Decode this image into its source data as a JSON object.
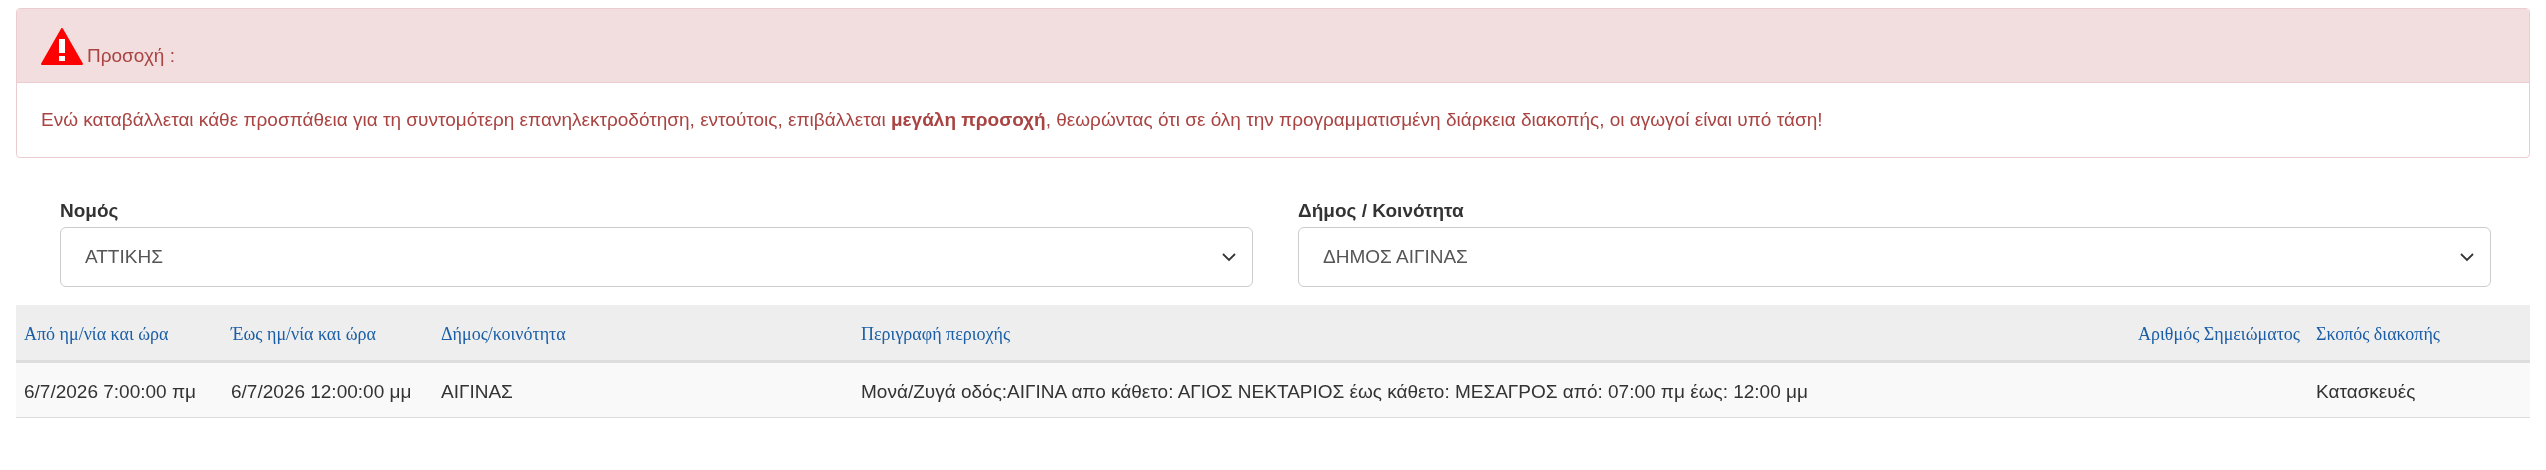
{
  "alert": {
    "title": "Προσοχή :",
    "message": "Ενώ καταβάλλεται κάθε προσπάθεια για τη συντομότερη επανηλεκτροδότηση, εντούτοις, επιβάλλεται **μεγάλη προσοχή**, θεωρώντας ότι σε όλη την προγραμματισμένη διάρκεια διακοπής, οι αγωγοί είναι υπό τάση!"
  },
  "filters": [
    {
      "label": "Νομός",
      "value": "ΑΤΤΙΚΗΣ"
    },
    {
      "label": "Δήμος / Κοινότητα",
      "value": "ΔΗΜΟΣ ΑΙΓΙΝΑΣ"
    }
  ],
  "table": {
    "columns": [
      "Από ημ/νία και ώρα",
      "Έως ημ/νία και ώρα",
      "Δήμος/κοινότητα",
      "Περιγραφή περιοχής",
      "Αριθμός Σημειώματος",
      "Σκοπός διακοπής"
    ],
    "rows": [
      [
        "6/7/2026 7:00:00 πμ",
        "6/7/2026 12:00:00 μμ",
        "ΑΙΓΙΝΑΣ",
        "Μονά/Ζυγά οδός:ΑΙΓΙΝΑ απο κάθετο: ΑΓΙΟΣ ΝΕΚΤΑΡΙΟΣ έως κάθετο: ΜΕΣΑΓΡΟΣ από: 07:00 πμ έως: 12:00 μμ",
        "",
        "Κατασκευές"
      ]
    ]
  }
}
